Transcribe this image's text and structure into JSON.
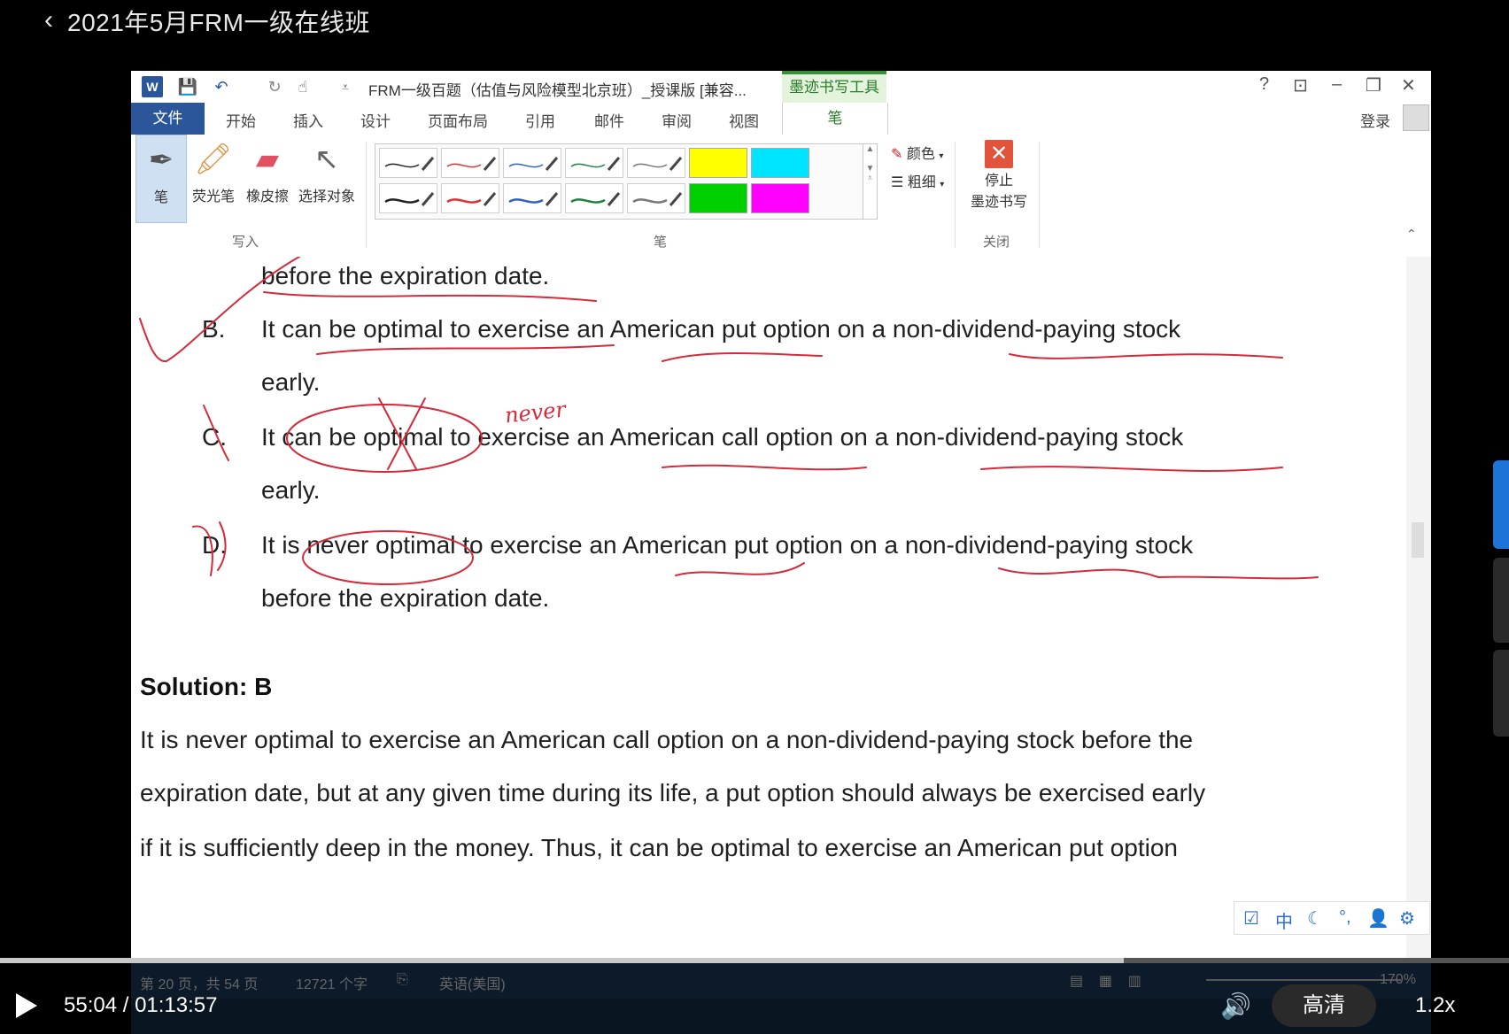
{
  "player": {
    "title": "2021年5月FRM一级在线班",
    "time": "55:04 / 01:13:57",
    "progress": 0.745,
    "quality": "高清",
    "speed": "1.2x"
  },
  "word": {
    "doc_title": "FRM一级百题（估值与风险模型北京班）_授课版 [兼容...",
    "ink_tools_label": "墨迹书写工具",
    "help": "?",
    "tabs": [
      "文件",
      "开始",
      "插入",
      "设计",
      "页面布局",
      "引用",
      "邮件",
      "审阅",
      "视图",
      "笔"
    ],
    "login": "登录",
    "ribbon": {
      "pen": "笔",
      "highlighter": "荧光笔",
      "eraser": "橡皮擦",
      "select": "选择对象",
      "group_write": "写入",
      "group_pen": "笔",
      "color": "颜色",
      "thickness": "粗细",
      "stop_line1": "停止",
      "stop_line2": "墨迹书写",
      "group_close": "关闭"
    },
    "pen_colors": [
      "#222222",
      "#e03030",
      "#3060c0",
      "#208040",
      "#777777"
    ],
    "highlight_colors": [
      "#ffff00",
      "#00e5ff",
      "#00d000",
      "#ff00ff"
    ],
    "ime": [
      "中"
    ]
  },
  "document": {
    "line_a_tail": "before the expiration date.",
    "option_b_label": "B.",
    "option_b_text": "It can be optimal to exercise an American put option on a non-dividend-paying stock",
    "option_b_cont": "early.",
    "option_c_label": "C.",
    "option_c_text": "It can be optimal to exercise an American call option on a non-dividend-paying stock",
    "option_c_cont": "early.",
    "option_d_label": "D.",
    "option_d_text": "It is never optimal to exercise an American put option on a non-dividend-paying stock",
    "option_d_cont": "before the expiration date.",
    "annotation": "never",
    "solution": "Solution: B",
    "explanation": [
      "It is never optimal to exercise an American call option on a non-dividend-paying stock before the",
      "expiration date, but at any given time during its life, a put option should always be exercised early",
      "if it is sufficiently deep in the money. Thus, it can be optimal to exercise an American put option"
    ]
  },
  "status": {
    "page": "第 20 页，共 54 页",
    "words": "12721 个字",
    "language": "英语(美国)",
    "zoom": "170%"
  }
}
